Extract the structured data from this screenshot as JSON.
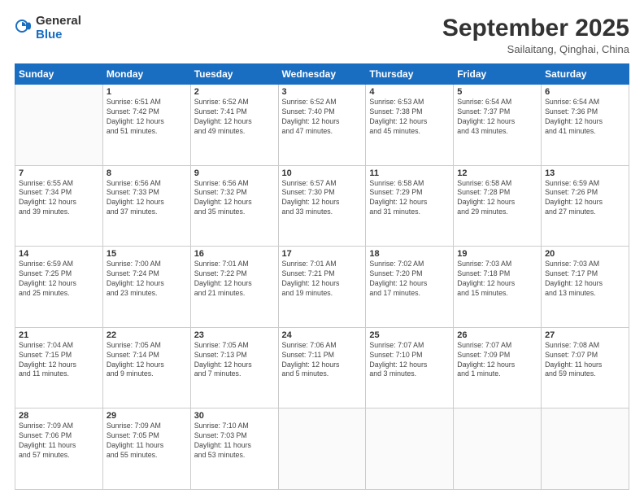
{
  "header": {
    "logo_general": "General",
    "logo_blue": "Blue",
    "month": "September 2025",
    "location": "Sailaitang, Qinghai, China"
  },
  "weekdays": [
    "Sunday",
    "Monday",
    "Tuesday",
    "Wednesday",
    "Thursday",
    "Friday",
    "Saturday"
  ],
  "weeks": [
    [
      {
        "day": "",
        "info": ""
      },
      {
        "day": "1",
        "info": "Sunrise: 6:51 AM\nSunset: 7:42 PM\nDaylight: 12 hours\nand 51 minutes."
      },
      {
        "day": "2",
        "info": "Sunrise: 6:52 AM\nSunset: 7:41 PM\nDaylight: 12 hours\nand 49 minutes."
      },
      {
        "day": "3",
        "info": "Sunrise: 6:52 AM\nSunset: 7:40 PM\nDaylight: 12 hours\nand 47 minutes."
      },
      {
        "day": "4",
        "info": "Sunrise: 6:53 AM\nSunset: 7:38 PM\nDaylight: 12 hours\nand 45 minutes."
      },
      {
        "day": "5",
        "info": "Sunrise: 6:54 AM\nSunset: 7:37 PM\nDaylight: 12 hours\nand 43 minutes."
      },
      {
        "day": "6",
        "info": "Sunrise: 6:54 AM\nSunset: 7:36 PM\nDaylight: 12 hours\nand 41 minutes."
      }
    ],
    [
      {
        "day": "7",
        "info": "Sunrise: 6:55 AM\nSunset: 7:34 PM\nDaylight: 12 hours\nand 39 minutes."
      },
      {
        "day": "8",
        "info": "Sunrise: 6:56 AM\nSunset: 7:33 PM\nDaylight: 12 hours\nand 37 minutes."
      },
      {
        "day": "9",
        "info": "Sunrise: 6:56 AM\nSunset: 7:32 PM\nDaylight: 12 hours\nand 35 minutes."
      },
      {
        "day": "10",
        "info": "Sunrise: 6:57 AM\nSunset: 7:30 PM\nDaylight: 12 hours\nand 33 minutes."
      },
      {
        "day": "11",
        "info": "Sunrise: 6:58 AM\nSunset: 7:29 PM\nDaylight: 12 hours\nand 31 minutes."
      },
      {
        "day": "12",
        "info": "Sunrise: 6:58 AM\nSunset: 7:28 PM\nDaylight: 12 hours\nand 29 minutes."
      },
      {
        "day": "13",
        "info": "Sunrise: 6:59 AM\nSunset: 7:26 PM\nDaylight: 12 hours\nand 27 minutes."
      }
    ],
    [
      {
        "day": "14",
        "info": "Sunrise: 6:59 AM\nSunset: 7:25 PM\nDaylight: 12 hours\nand 25 minutes."
      },
      {
        "day": "15",
        "info": "Sunrise: 7:00 AM\nSunset: 7:24 PM\nDaylight: 12 hours\nand 23 minutes."
      },
      {
        "day": "16",
        "info": "Sunrise: 7:01 AM\nSunset: 7:22 PM\nDaylight: 12 hours\nand 21 minutes."
      },
      {
        "day": "17",
        "info": "Sunrise: 7:01 AM\nSunset: 7:21 PM\nDaylight: 12 hours\nand 19 minutes."
      },
      {
        "day": "18",
        "info": "Sunrise: 7:02 AM\nSunset: 7:20 PM\nDaylight: 12 hours\nand 17 minutes."
      },
      {
        "day": "19",
        "info": "Sunrise: 7:03 AM\nSunset: 7:18 PM\nDaylight: 12 hours\nand 15 minutes."
      },
      {
        "day": "20",
        "info": "Sunrise: 7:03 AM\nSunset: 7:17 PM\nDaylight: 12 hours\nand 13 minutes."
      }
    ],
    [
      {
        "day": "21",
        "info": "Sunrise: 7:04 AM\nSunset: 7:15 PM\nDaylight: 12 hours\nand 11 minutes."
      },
      {
        "day": "22",
        "info": "Sunrise: 7:05 AM\nSunset: 7:14 PM\nDaylight: 12 hours\nand 9 minutes."
      },
      {
        "day": "23",
        "info": "Sunrise: 7:05 AM\nSunset: 7:13 PM\nDaylight: 12 hours\nand 7 minutes."
      },
      {
        "day": "24",
        "info": "Sunrise: 7:06 AM\nSunset: 7:11 PM\nDaylight: 12 hours\nand 5 minutes."
      },
      {
        "day": "25",
        "info": "Sunrise: 7:07 AM\nSunset: 7:10 PM\nDaylight: 12 hours\nand 3 minutes."
      },
      {
        "day": "26",
        "info": "Sunrise: 7:07 AM\nSunset: 7:09 PM\nDaylight: 12 hours\nand 1 minute."
      },
      {
        "day": "27",
        "info": "Sunrise: 7:08 AM\nSunset: 7:07 PM\nDaylight: 11 hours\nand 59 minutes."
      }
    ],
    [
      {
        "day": "28",
        "info": "Sunrise: 7:09 AM\nSunset: 7:06 PM\nDaylight: 11 hours\nand 57 minutes."
      },
      {
        "day": "29",
        "info": "Sunrise: 7:09 AM\nSunset: 7:05 PM\nDaylight: 11 hours\nand 55 minutes."
      },
      {
        "day": "30",
        "info": "Sunrise: 7:10 AM\nSunset: 7:03 PM\nDaylight: 11 hours\nand 53 minutes."
      },
      {
        "day": "",
        "info": ""
      },
      {
        "day": "",
        "info": ""
      },
      {
        "day": "",
        "info": ""
      },
      {
        "day": "",
        "info": ""
      }
    ]
  ]
}
